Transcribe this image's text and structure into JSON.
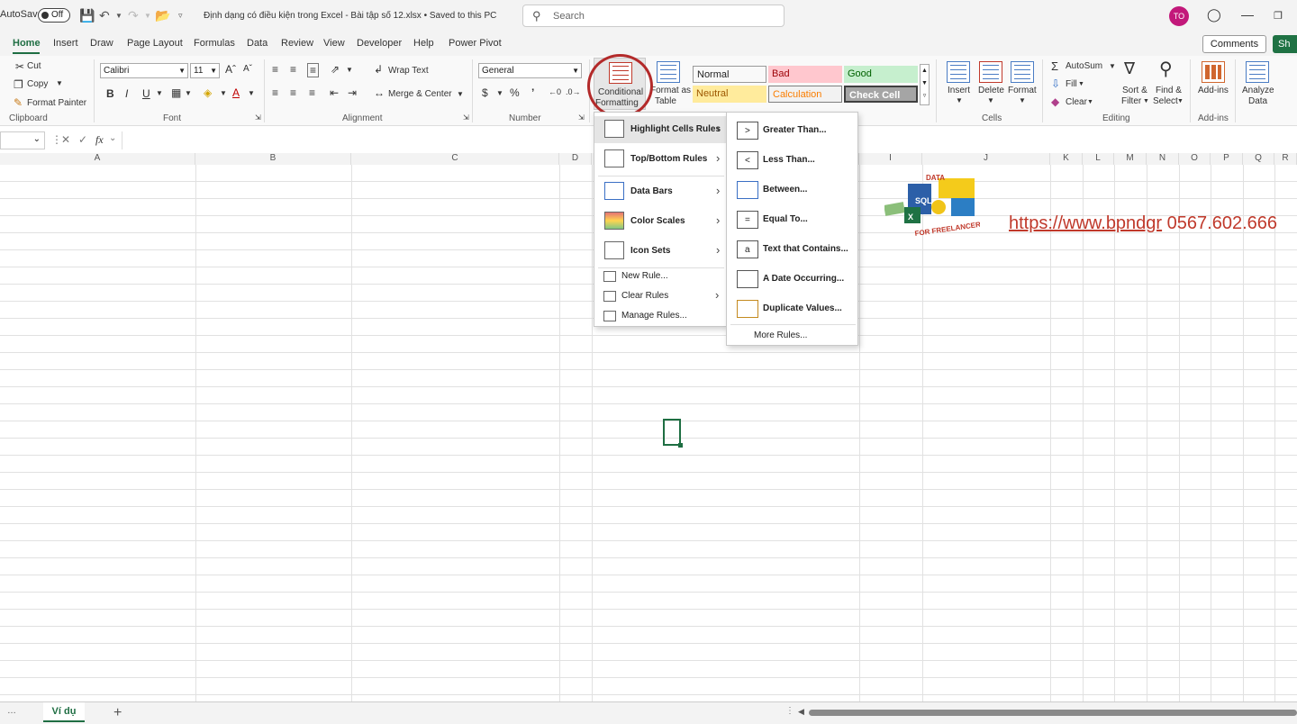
{
  "titlebar": {
    "autosave_label": "AutoSave",
    "autosave_state": "Off",
    "document_title": "Định dạng có điều kiện trong Excel  -  Bài tập số 12.xlsx  •  Saved to this PC",
    "search_placeholder": "Search",
    "user_initials": "TO"
  },
  "menu_tabs": [
    "Home",
    "Insert",
    "Draw",
    "Page Layout",
    "Formulas",
    "Data",
    "Review",
    "View",
    "Developer",
    "Help",
    "Power Pivot"
  ],
  "comments_label": "Comments",
  "share_label": "Sh",
  "ribbon": {
    "clipboard": {
      "cut": "Cut",
      "copy": "Copy",
      "format_painter": "Format Painter",
      "label": "Clipboard"
    },
    "font": {
      "family": "Calibri",
      "size": "11",
      "bold": "B",
      "italic": "I",
      "underline": "U",
      "label": "Font"
    },
    "alignment": {
      "wrap_text": "Wrap Text",
      "merge_center": "Merge & Center",
      "label": "Alignment"
    },
    "number": {
      "format": "General",
      "label": "Number"
    },
    "styles": {
      "conditional_formatting_line1": "Conditional",
      "conditional_formatting_line2": "Formatting",
      "format_as_table_line1": "Format as",
      "format_as_table_line2": "Table",
      "cells": [
        {
          "name": "Normal",
          "bg": "#ffffff",
          "fg": "#000000"
        },
        {
          "name": "Bad",
          "bg": "#ffc7ce",
          "fg": "#9c0006"
        },
        {
          "name": "Good",
          "bg": "#c6efce",
          "fg": "#006100"
        },
        {
          "name": "Neutral",
          "bg": "#ffeb9c",
          "fg": "#9c5700"
        },
        {
          "name": "Calculation",
          "bg": "#f2f2f2",
          "fg": "#fa7d00"
        },
        {
          "name": "Check Cell",
          "bg": "#a5a5a5",
          "fg": "#ffffff"
        }
      ]
    },
    "cells": {
      "insert": "Insert",
      "delete": "Delete",
      "format": "Format",
      "label": "Cells"
    },
    "editing": {
      "autosum": "AutoSum",
      "fill": "Fill",
      "clear": "Clear",
      "sort_filter_1": "Sort &",
      "sort_filter_2": "Filter",
      "find_select_1": "Find &",
      "find_select_2": "Select",
      "label": "Editing"
    },
    "addins": {
      "addins": "Add-ins",
      "label": "Add-ins"
    },
    "analyze": {
      "line1": "Analyze",
      "line2": "Data"
    }
  },
  "formula_bar": {
    "fx": "fx"
  },
  "columns": [
    "A",
    "B",
    "C",
    "D",
    "I",
    "J",
    "K",
    "L",
    "M",
    "N",
    "O",
    "P",
    "Q",
    "R"
  ],
  "sheet": {
    "link": "https://www.bpndgr",
    "phone": "0567.602.666",
    "banner_top": "DATA",
    "banner_bottom": "FOR FREELANCERS"
  },
  "cf_menu": {
    "items": [
      {
        "label": "Highlight Cells Rules",
        "has_sub": true
      },
      {
        "label": "Top/Bottom Rules",
        "has_sub": true
      },
      {
        "label": "Data Bars",
        "has_sub": true
      },
      {
        "label": "Color Scales",
        "has_sub": true
      },
      {
        "label": "Icon Sets",
        "has_sub": true
      }
    ],
    "small_items": [
      {
        "label": "New Rule...",
        "has_sub": false
      },
      {
        "label": "Clear Rules",
        "has_sub": true
      },
      {
        "label": "Manage Rules...",
        "has_sub": false
      }
    ]
  },
  "highlight_submenu": {
    "items": [
      {
        "label": "Greater Than...",
        "glyph": ">"
      },
      {
        "label": "Less Than...",
        "glyph": "<"
      },
      {
        "label": "Between...",
        "glyph": ""
      },
      {
        "label": "Equal To...",
        "glyph": "="
      },
      {
        "label": "Text that Contains...",
        "glyph": "a"
      },
      {
        "label": "A Date Occurring...",
        "glyph": ""
      },
      {
        "label": "Duplicate Values...",
        "glyph": ""
      }
    ],
    "more_rules": "More Rules..."
  },
  "sheet_tabs": {
    "active": "Ví dụ"
  }
}
